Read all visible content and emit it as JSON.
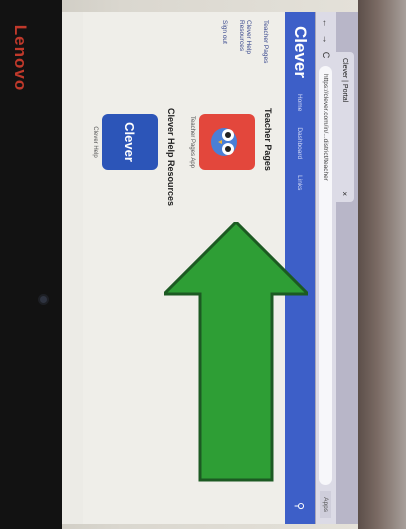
{
  "device": {
    "brand": "Lenovo"
  },
  "browser": {
    "tab_title": "Clever | Portal",
    "tab_close": "×",
    "back": "←",
    "forward": "→",
    "reload": "C",
    "address": "https://clever.com/in/...district/teacher",
    "apps_label": "Apps"
  },
  "clever": {
    "logo": "Clever",
    "nav": [
      "Home",
      "Dashboard",
      "Links"
    ],
    "search_glyph": "⚲"
  },
  "sidebar": {
    "items": [
      "Teacher Pages",
      "Clever Help Resources",
      "Sign out"
    ]
  },
  "main": {
    "teacher_pages_title": "Teacher Pages",
    "teacher_app_caption": "Teacher Pages App",
    "help_title": "Clever Help Resources",
    "help_app_label": "Clever",
    "help_app_caption": "Clever Help"
  },
  "colors": {
    "clever_blue": "#3d5fc8",
    "arrow_green": "#2e9e35",
    "owl_red": "#e3473c"
  }
}
